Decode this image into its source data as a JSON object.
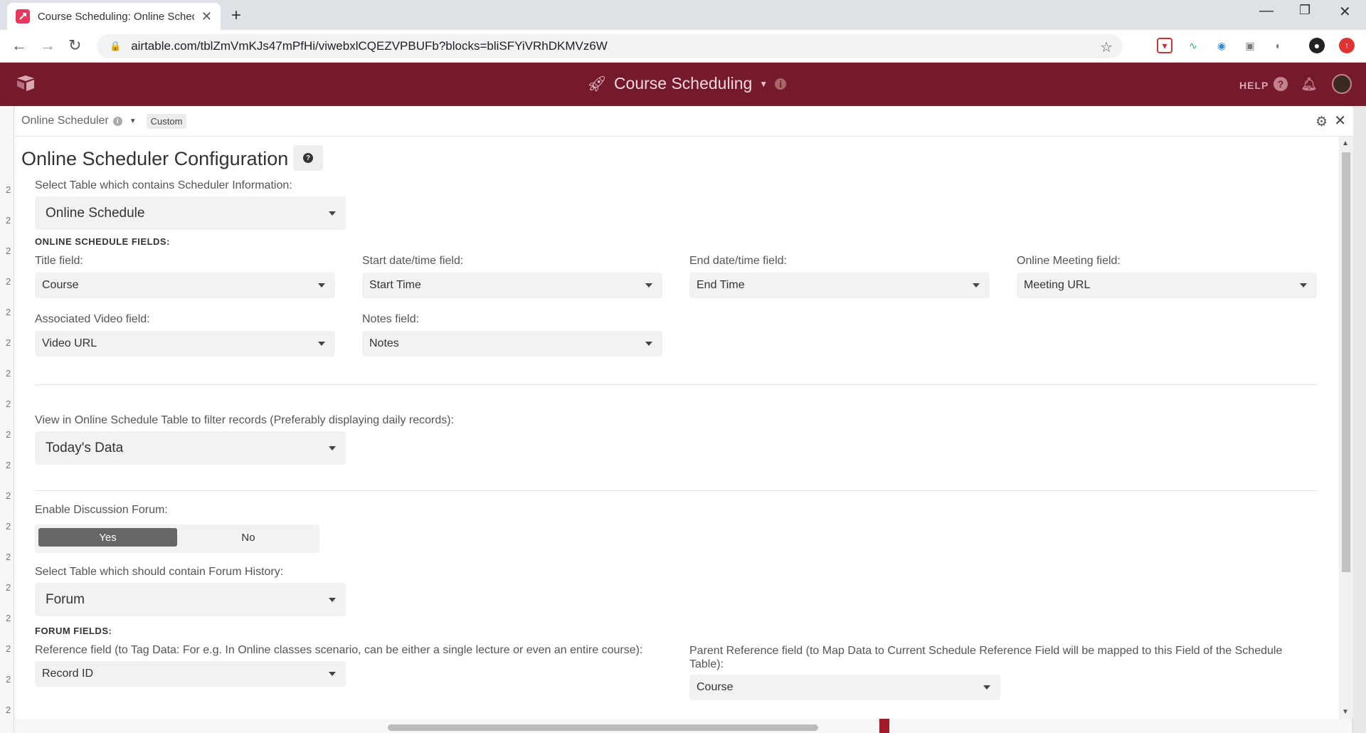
{
  "browser": {
    "tab_title": "Course Scheduling: Online Scheduler",
    "url": "airtable.com/tblZmVmKJs47mPfHi/viwebxlCQEZVPBUFb?blocks=bliSFYiVRhDKMVz6W"
  },
  "header": {
    "base_name": "Course Scheduling",
    "help_label": "HELP"
  },
  "panel": {
    "name": "Online Scheduler",
    "badge": "Custom"
  },
  "config": {
    "title": "Online Scheduler Configuration",
    "schedule_table_label": "Select Table which contains Scheduler Information:",
    "schedule_table_value": "Online Schedule",
    "schedule_fields_heading": "ONLINE SCHEDULE FIELDS:",
    "fields": {
      "title_label": "Title field:",
      "title_value": "Course",
      "start_label": "Start date/time field:",
      "start_value": "Start Time",
      "end_label": "End date/time field:",
      "end_value": "End Time",
      "meeting_label": "Online Meeting field:",
      "meeting_value": "Meeting URL",
      "video_label": "Associated Video field:",
      "video_value": "Video URL",
      "notes_label": "Notes field:",
      "notes_value": "Notes"
    },
    "view_label": "View in Online Schedule Table to filter records (Preferably displaying daily records):",
    "view_value": "Today's Data",
    "forum_enable_label": "Enable Discussion Forum:",
    "forum_yes": "Yes",
    "forum_no": "No",
    "forum_table_label": "Select Table which should contain Forum History:",
    "forum_table_value": "Forum",
    "forum_fields_heading": "FORUM FIELDS:",
    "reference_label": "Reference field (to Tag Data: For e.g. In Online classes scenario, can be either a single lecture or even an entire course):",
    "reference_value": "Record ID",
    "parent_reference_label": "Parent Reference field (to Map Data to Current Schedule Reference Field will be mapped to this Field of the Schedule Table):",
    "parent_reference_value": "Course"
  },
  "background_row_numbers": [
    "2",
    "2",
    "2",
    "2",
    "2",
    "2",
    "2",
    "2",
    "2",
    "2",
    "2",
    "2",
    "2",
    "2",
    "2",
    "2",
    "2",
    "2"
  ]
}
